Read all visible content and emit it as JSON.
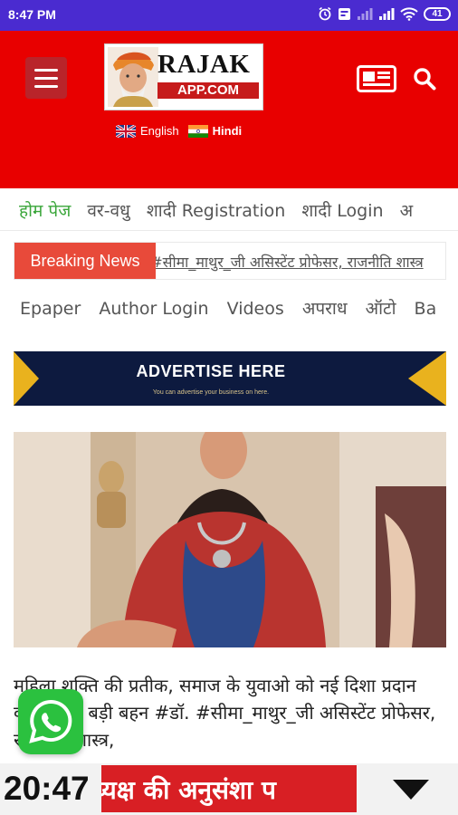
{
  "status_bar": {
    "time": "8:47 PM",
    "battery": "41"
  },
  "header": {
    "logo_line1": "RAJAK",
    "logo_line2": "APP.COM",
    "languages": [
      "English",
      "Hindi"
    ]
  },
  "nav_primary": [
    "होम पेज",
    "वर-वधु",
    "शादी Registration",
    "शादी Login",
    "अ"
  ],
  "breaking": {
    "label": "Breaking News",
    "ticker": "न #डॉ. #सीमा_माथुर_जी असिस्टेंट प्रोफेसर, राजनीति शास्त्र"
  },
  "nav_secondary": [
    "Epaper",
    "Author Login",
    "Videos",
    "अपराध",
    "ऑटो",
    "Ba"
  ],
  "ad": {
    "title": "ADVERTISE HERE",
    "subtitle": "You can advertise your business on here."
  },
  "article": {
    "headline": "महिला शक्ति की प्रतीक, समाज के युवाओ को नई दिशा प्रदान करने वाली बड़ी बहन #डॉ. #सीमा_माथुर_जी असिस्टेंट प्रोफेसर, राजनीति शास्त्र,"
  },
  "bottom_bar": {
    "clock": "20:47",
    "ticker": "ध्यक्ष की अनुसंशा प"
  },
  "colors": {
    "status_bar": "#4a2bd0",
    "header": "#e80000",
    "accent_green": "#3aa63a",
    "breaking": "#e84a3a",
    "whatsapp": "#2bc13f"
  }
}
